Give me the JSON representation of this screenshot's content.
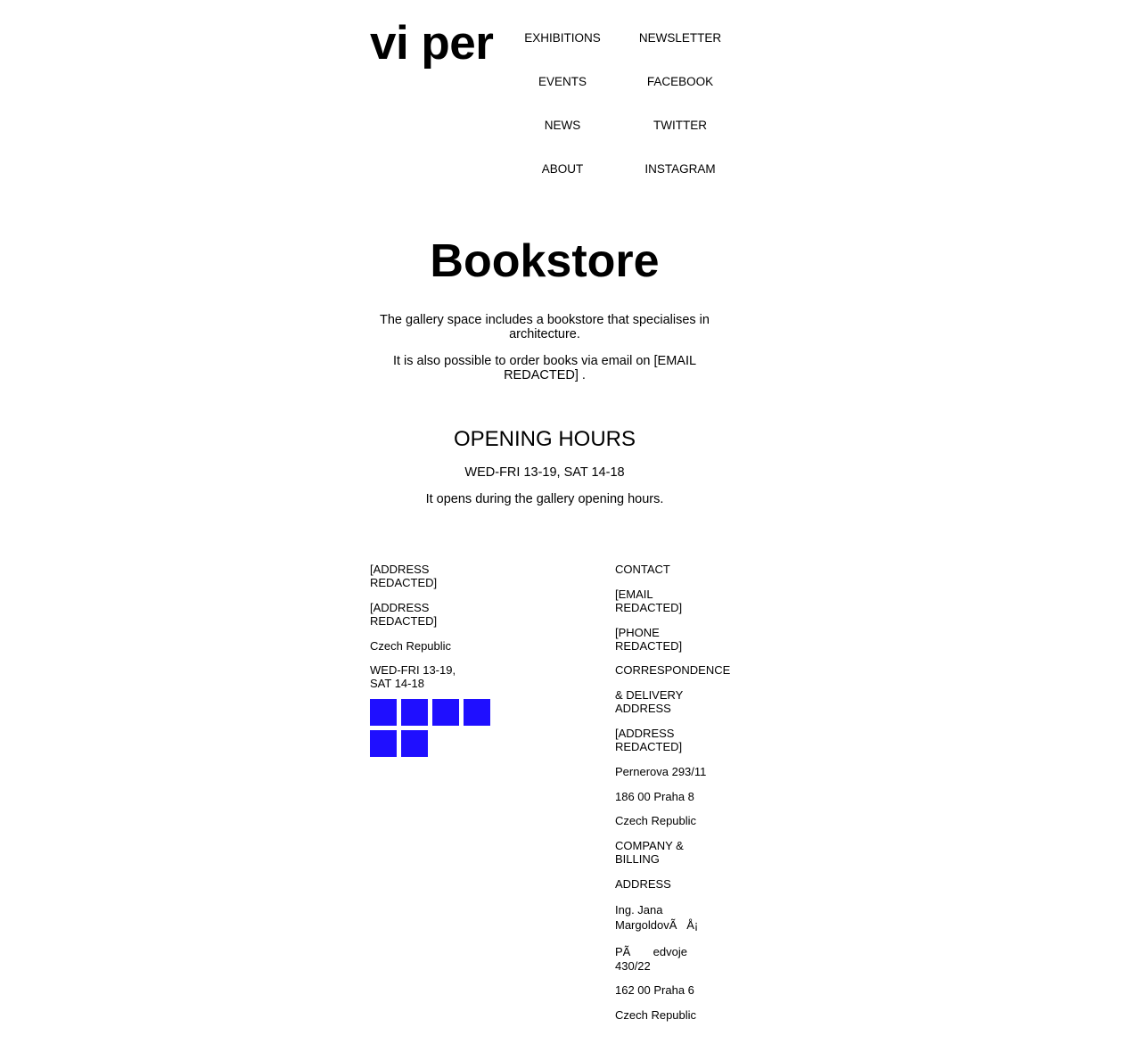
{
  "header": {
    "logo": "vi per",
    "nav_left": [
      "EXHIBITIONS",
      "EVENTS",
      "NEWS",
      "ABOUT"
    ],
    "nav_right": [
      "NEWSLETTER",
      "FACEBOOK",
      "TWITTER",
      "INSTAGRAM"
    ]
  },
  "main": {
    "title": "Bookstore",
    "paragraphs": [
      "The gallery space includes a bookstore that specialises in architecture.",
      "It is also possible to order books via email on [EMAIL REDACTED] ."
    ],
    "hours_heading": "OPENING HOURS",
    "hours_time": "WED-FRI 13-19, SAT 14-18",
    "hours_note": "It opens during the gallery opening hours."
  },
  "footer": {
    "left": [
      "[ADDRESS REDACTED]",
      "[ADDRESS REDACTED]",
      "Czech Republic",
      "WED-FRI 13-19, SAT 14-18"
    ],
    "social_icon_color": "#1f0fff",
    "right": [
      "CONTACT",
      "[EMAIL REDACTED]",
      "[PHONE REDACTED]",
      "CORRESPONDENCE",
      "& DELIVERY ADDRESS",
      "[ADDRESS REDACTED]",
      "Pernerova 293/11",
      "186 00 Praha 8",
      "Czech Republic",
      "COMPANY & BILLING",
      "ADDRESS",
      "Ing. Jana MargoldovÃ   Å¡",
      "PÃ       edvoje 430/22",
      "162 00 Praha 6",
      "Czech Republic"
    ]
  }
}
